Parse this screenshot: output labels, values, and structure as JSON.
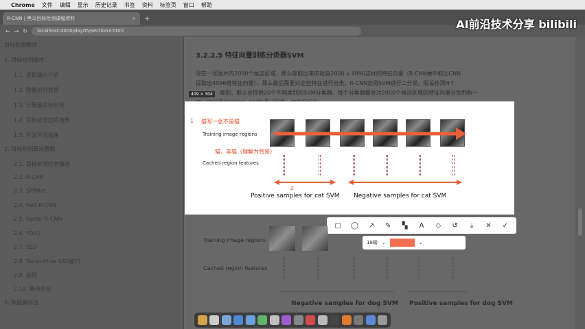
{
  "menubar": {
    "apple": "",
    "app": "Chrome",
    "items": [
      "文件",
      "编辑",
      "显示",
      "历史记录",
      "书签",
      "资料",
      "标签页",
      "窗口",
      "帮助"
    ]
  },
  "tab": {
    "title": "R-CNN | 黑马目标检测课程资料",
    "close": "×",
    "new": "+"
  },
  "address": {
    "url": "localhost:4000/day05/section3.html"
  },
  "watermark": {
    "text": "AI前沿技术分享",
    "logo": "bilibili"
  },
  "sidebar": {
    "items": [
      "目标检测概述",
      "1. 目标检测概述",
      "1.1. 项目演示介绍",
      "1.2. 图像识别背景",
      "1.3. 计算最目标检测",
      "1.4. 目标检测应用场景",
      "1.5. 开发环境搭建",
      "2. 目标检测算法原理",
      "2.1. 目标检测任务描述",
      "2.2. R-CNN",
      "2.3. SPPNet",
      "2.4. Fast R-CNN",
      "2.5. Faster R-CNN",
      "2.6. YOLO",
      "2.7. SSD",
      "2.8. TensorFlow SSD接口",
      "2.9. 总结",
      "2.10. 备份作业",
      "3. 数据集标注"
    ]
  },
  "content": {
    "heading": "3.2.2.5 特征向量训练分类器SVM",
    "para1": "现在一张图片的2000个候选区域，那么提取出来的就是2000 x 4096这样的特征向量（R-CNN抽中取出CNN",
    "para2": "提取出4096维特征向量）。那么最后需要对这些特征进行分类。R-CNN选用SVM进行二分类。假设检测N个",
    "para3": "类别，那么会提供20个不同类别的SVM分类器。每个分类器都会对2000个候选区域的特征向量分别判断一",
    "para4": "次，这样得出[2000, 20]的得分矩阵，如下图所示"
  },
  "selection": {
    "size": "409 × 304"
  },
  "figure": {
    "row1": "Training image regions",
    "row2": "Cached region features",
    "pos": "Positive samples for cat SVM",
    "neg": "Negative samples for cat SVM",
    "note1": "1",
    "note2": "2",
    "anno_top": "猫写一张不是猫",
    "anno_mid": "猫，非猫（理解为背景）"
  },
  "toolbar": {
    "tools": [
      "rect-icon",
      "ellipse-icon",
      "arrow-icon",
      "pen-icon",
      "mosaic-icon",
      "text-icon",
      "eraser-icon",
      "undo-icon",
      "save-icon",
      "close-icon",
      "check-icon"
    ]
  },
  "subbar": {
    "size": "18磅",
    "size_arrow": "⌄",
    "color": "#f07050",
    "color_arrow": "⌄"
  },
  "lower": {
    "row1": "Training image regions",
    "row2": "Cached region features",
    "neg": "Negative samples for dog SVM",
    "pos": "Positive samples for dog SVM"
  },
  "dock": {
    "colors": [
      "#d6a34a",
      "#cccccc",
      "#7aa7d9",
      "#4f86d6",
      "#6a9fe0",
      "#5fb36a",
      "#c0c0c0",
      "#a05ad0",
      "#888",
      "#d24a4a",
      "#bbbbbb",
      "#444",
      "#e07a30",
      "#777",
      "#5a8ad6",
      "#999"
    ]
  }
}
